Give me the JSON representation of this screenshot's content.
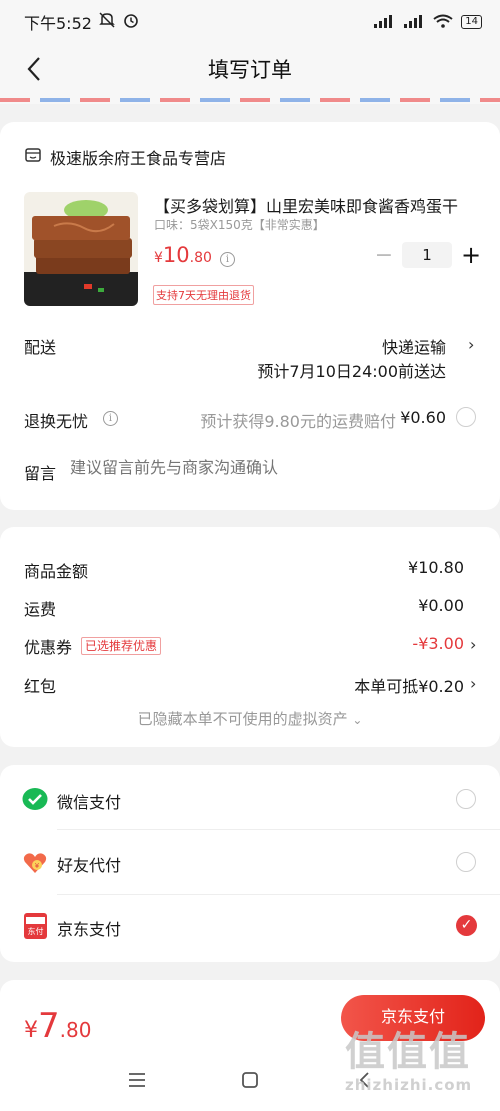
{
  "status": {
    "time": "下午5:52",
    "battery": "14"
  },
  "nav": {
    "title": "填写订单"
  },
  "shop": {
    "name": "极速版余府王食品专营店"
  },
  "product": {
    "title": "【买多袋划算】山里宏美味即食酱香鸡蛋干",
    "spec": "口味：5袋X150克【非常实惠】",
    "price_symbol": "¥",
    "price_int": "10",
    "price_dec": ".80",
    "badge": "支持7天无理由退货",
    "quantity": "1"
  },
  "delivery": {
    "label": "配送",
    "method": "快递运输",
    "eta": "预计7月10日24:00前送达"
  },
  "returns": {
    "label": "退换无忧",
    "note": "预计获得9.80元的运费赔付",
    "price": "¥0.60"
  },
  "memo": {
    "label": "留言",
    "placeholder": "建议留言前先与商家沟通确认"
  },
  "summary": {
    "goods_label": "商品金额",
    "goods_value": "¥10.80",
    "shipping_label": "运费",
    "shipping_value": "¥0.00",
    "coupon_label": "优惠券",
    "coupon_badge": "已选推荐优惠",
    "coupon_value": "-¥3.00",
    "redpacket_label": "红包",
    "redpacket_value": "本单可抵¥0.20",
    "hidden_note": "已隐藏本单不可使用的虚拟资产"
  },
  "payment": {
    "options": [
      {
        "label": "微信支付",
        "icon": "wechat-pay-icon",
        "selected": false
      },
      {
        "label": "好友代付",
        "icon": "friend-pay-icon",
        "selected": false
      },
      {
        "label": "京东支付",
        "icon": "jd-pay-icon",
        "selected": true
      }
    ],
    "jd_icon_text": "东付"
  },
  "footer": {
    "total_symbol": "¥",
    "total_int": "7",
    "total_dec": ".80",
    "submit_label": "京东支付"
  },
  "watermark": {
    "text": "值值值",
    "sub": "zhizhizhi.com"
  },
  "colors": {
    "accent": "#e4393c",
    "wechat": "#19b955"
  }
}
